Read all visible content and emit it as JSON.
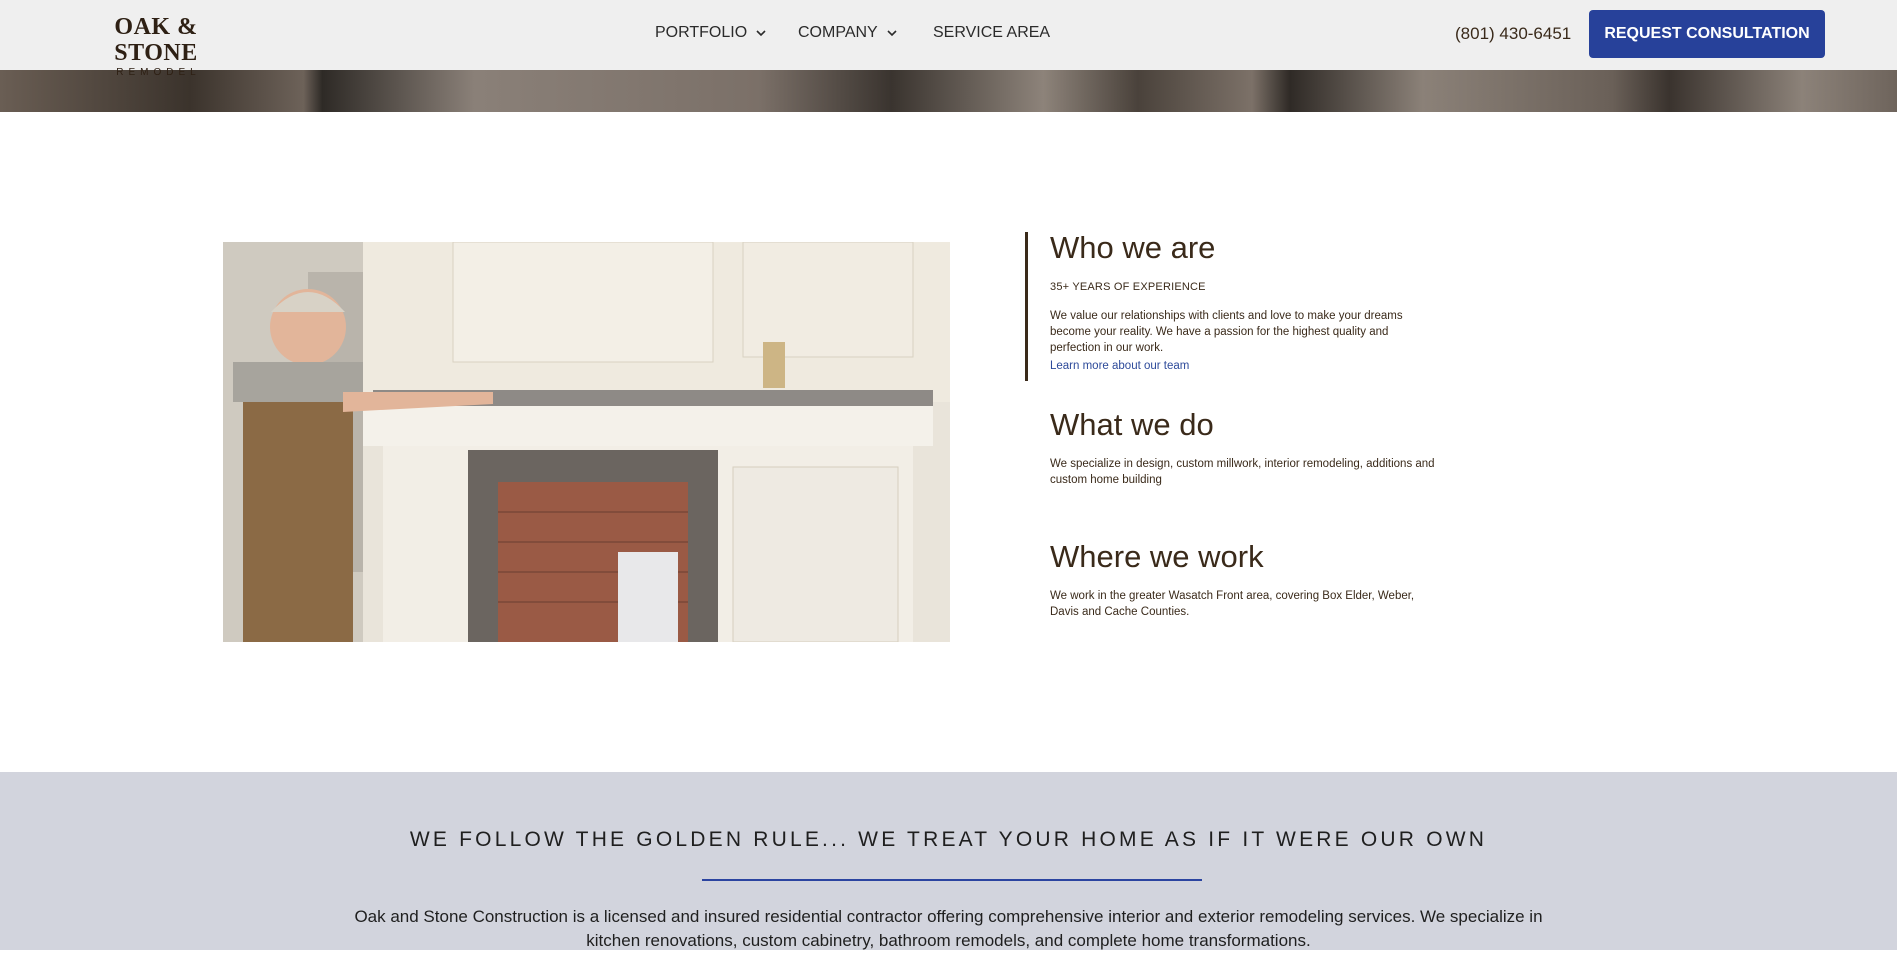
{
  "header": {
    "logo": {
      "main": "OAK & STONE",
      "sub": "REMODEL"
    },
    "nav": [
      {
        "label": "PORTFOLIO",
        "has_dropdown": true
      },
      {
        "label": "COMPANY",
        "has_dropdown": true
      },
      {
        "label": "SERVICE AREA",
        "has_dropdown": false
      }
    ],
    "phone": "(801) 430-6451",
    "cta_label": "REQUEST CONSULTATION"
  },
  "colors": {
    "header_bg": "#efefef",
    "cta_bg": "#27419a",
    "text_brown": "#3a2a1a",
    "link_blue": "#2d4a9a",
    "band_bg": "#d2d4dd"
  },
  "about": {
    "who": {
      "title": "Who we are",
      "kicker": "35+ YEARS OF EXPERIENCE",
      "text": "We value our relationships with clients and love to make your dreams become your reality. We have a passion for the highest quality and perfection in our work.",
      "link": "Learn more about our team"
    },
    "what": {
      "title": "What we do",
      "text": "We specialize in design, custom millwork, interior remodeling, additions and custom home building"
    },
    "where": {
      "title": "Where we work",
      "text": "We work in the greater Wasatch Front area, covering Box Elder, Weber, Davis and Cache Counties."
    }
  },
  "band": {
    "title": "WE FOLLOW THE GOLDEN RULE... WE TREAT YOUR HOME AS IF IT WERE OUR OWN",
    "text": "Oak and Stone Construction is a licensed and insured residential contractor offering comprehensive interior and exterior remodeling services. We specialize in kitchen renovations, custom cabinetry, bathroom remodels, and complete home transformations."
  },
  "icons": {
    "dropdown": "chevron-down-icon"
  }
}
